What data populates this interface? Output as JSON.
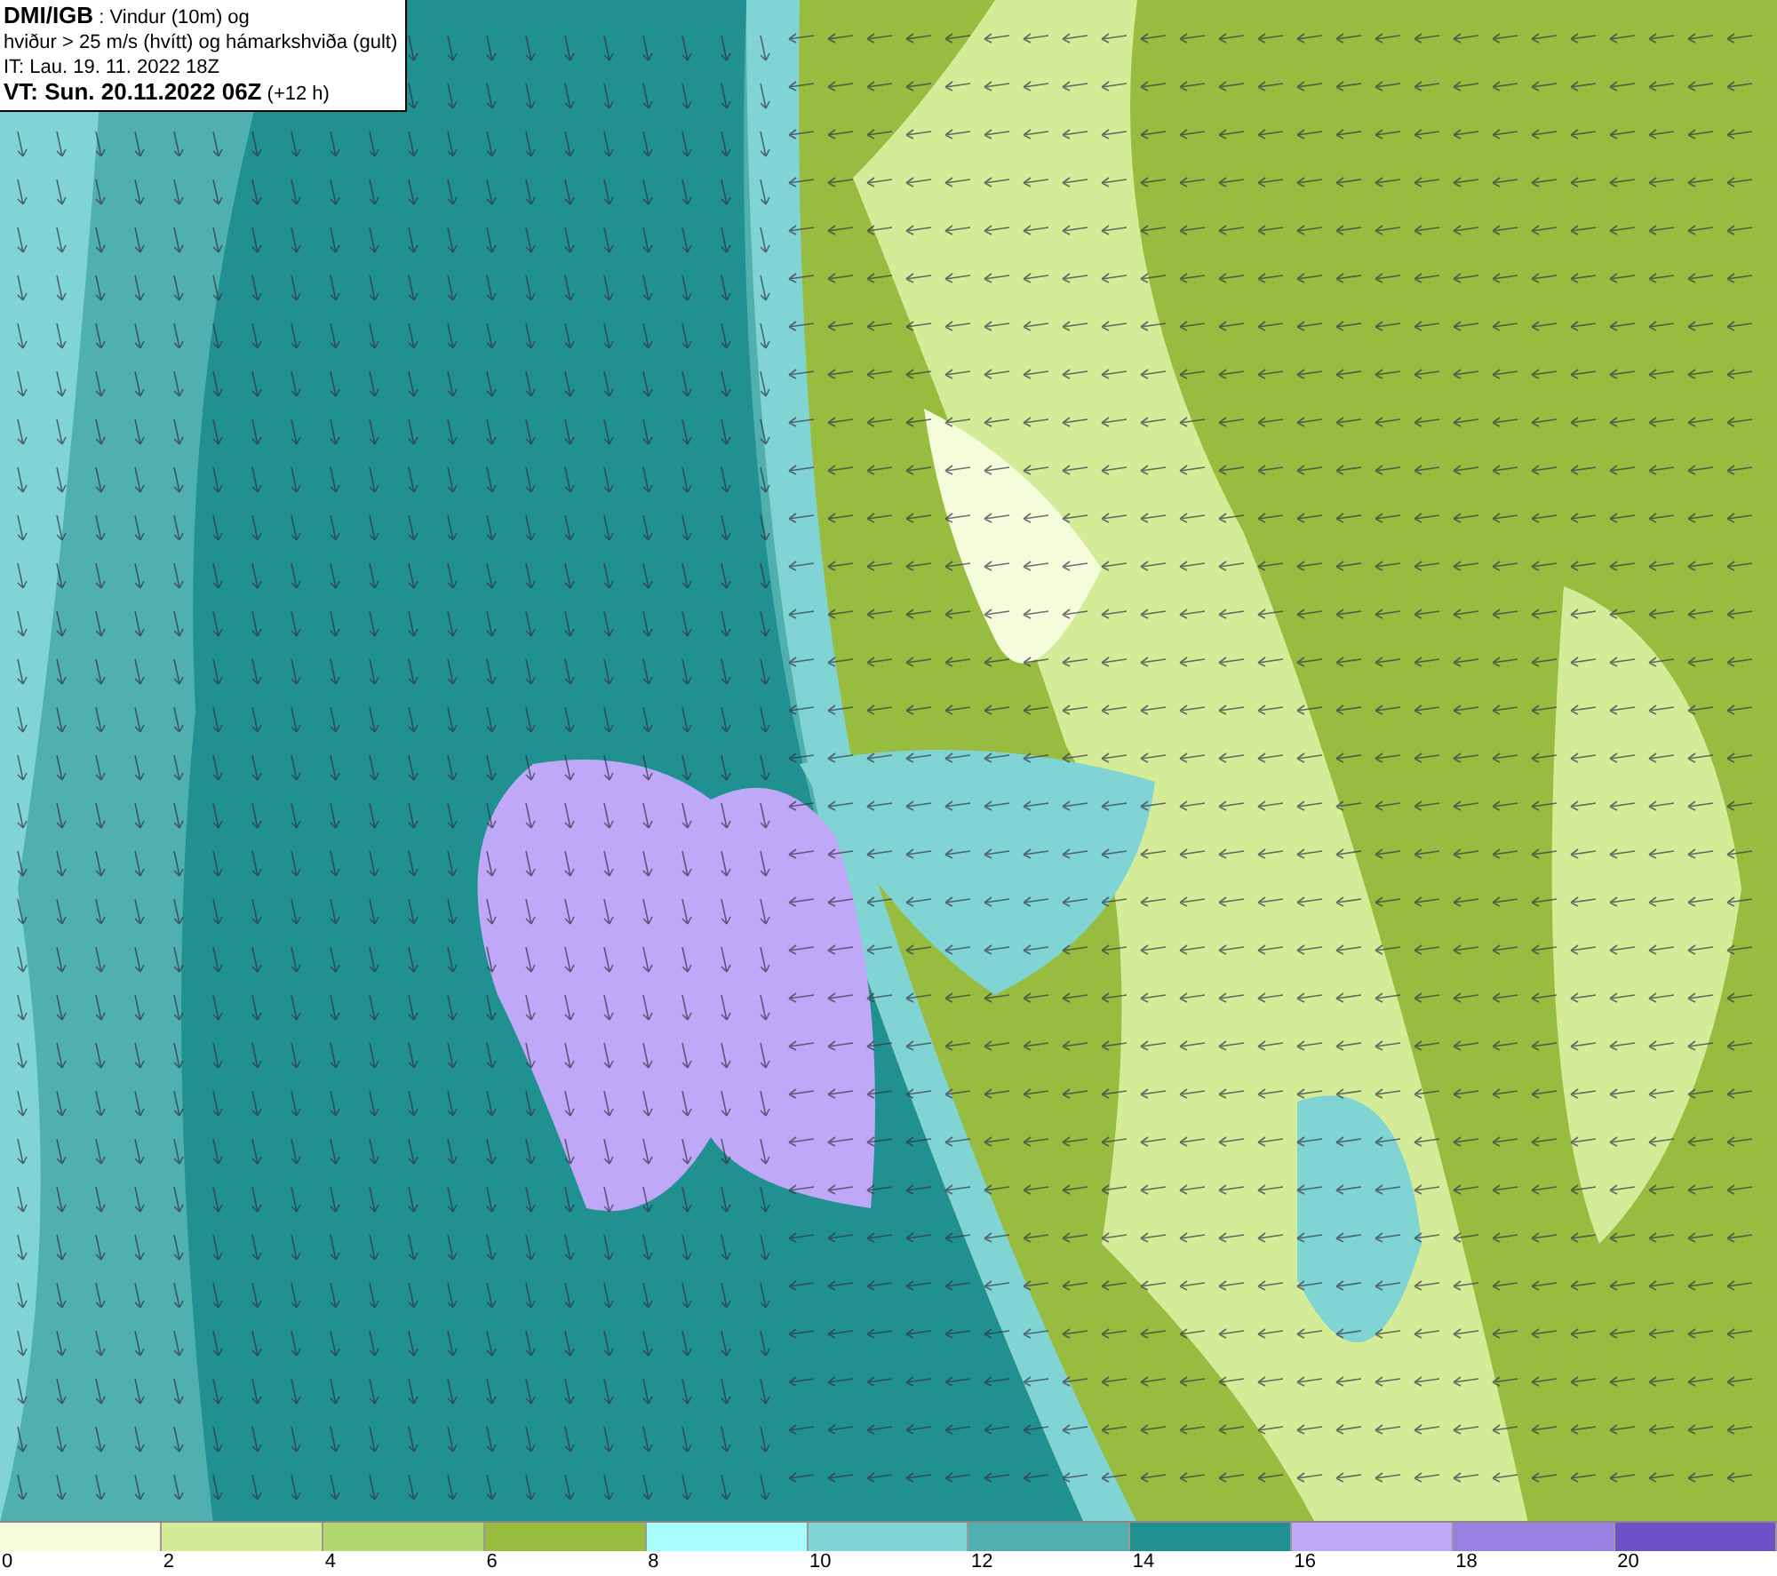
{
  "header": {
    "lines": [
      "**DMI/IGB** : Vindur (10m) og",
      "hviður > 25 m/s (hvítt) og hámarkshviða (gult)",
      "IT: Lau. 19. 11. 2022 18Z",
      "**VT: Sun. 20.11.2022 06Z** (+12 h)"
    ]
  },
  "legend": [
    {
      "label": "0",
      "color": "#f5fcdc"
    },
    {
      "label": "2",
      "color": "#d4ec98"
    },
    {
      "label": "4",
      "color": "#b4d870"
    },
    {
      "label": "6",
      "color": "#98bc40"
    },
    {
      "label": "8",
      "color": "#a8fcfc"
    },
    {
      "label": "10",
      "color": "#80d4d4"
    },
    {
      "label": "12",
      "color": "#50b0b0"
    },
    {
      "label": "14",
      "color": "#209090"
    },
    {
      "label": "16",
      "color": "#c0a8f8"
    },
    {
      "label": "18",
      "color": "#9880e0"
    },
    {
      "label": "20",
      "color": "#7050c8"
    }
  ]
}
